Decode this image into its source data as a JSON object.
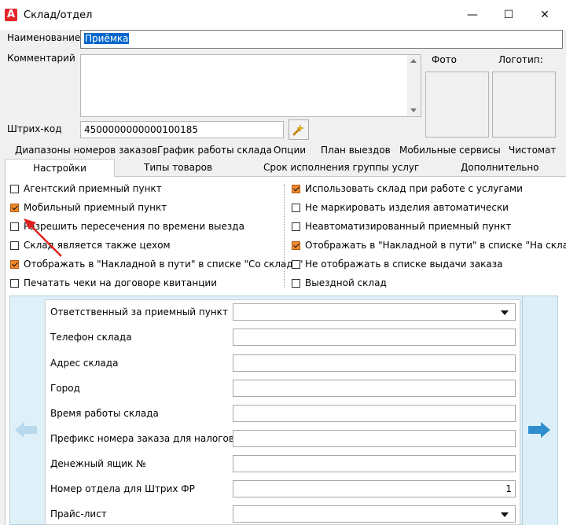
{
  "window": {
    "title": "Склад/отдел",
    "app_icon_letter": "A",
    "minimize": "—",
    "maximize": "☐",
    "close": "✕"
  },
  "form": {
    "name_label": "Наименование",
    "name_value": "Приёмка",
    "comment_label": "Комментарий",
    "comment_value": "",
    "photo_label": "Фото",
    "logo_label": "Логотип:",
    "barcode_label": "Штрих-код",
    "barcode_value": "4500000000000100185"
  },
  "tabs_top": [
    "Диапазоны номеров заказов",
    "График работы склада",
    "Опции",
    "План выездов",
    "Мобильные сервисы",
    "Чистомат"
  ],
  "tabs_bottom": [
    "Настройки",
    "Типы товаров",
    "Срок исполнения группы услуг",
    "Дополнительно"
  ],
  "active_tab": "Настройки",
  "checkboxes_left": [
    {
      "label": "Агентский приемный пункт",
      "checked": false
    },
    {
      "label": "Мобильный приемный пункт",
      "checked": true
    },
    {
      "label": "Разрешить пересечения по времени выезда",
      "checked": false
    },
    {
      "label": "Склад является также цехом",
      "checked": false
    },
    {
      "label": "Отображать в \"Накладной в пути\" в списке \"Со склада\"",
      "checked": true
    },
    {
      "label": "Печатать чеки на договоре квитанции",
      "checked": false
    }
  ],
  "checkboxes_right": [
    {
      "label": "Использовать склад при работе с услугами",
      "checked": true
    },
    {
      "label": "Не маркировать изделия автоматически",
      "checked": false
    },
    {
      "label": "Неавтоматизированный приемный пункт",
      "checked": false
    },
    {
      "label": "Отображать в \"Накладной в пути\" в списке \"На склад\"",
      "checked": true
    },
    {
      "label": "Не отображать в списке выдачи заказа",
      "checked": false
    },
    {
      "label": "Выездной склад",
      "checked": false
    }
  ],
  "fields": [
    {
      "label": "Ответственный за приемный пункт",
      "value": "",
      "type": "dropdown"
    },
    {
      "label": "Телефон склада",
      "value": "",
      "type": "text"
    },
    {
      "label": "Адрес склада",
      "value": "",
      "type": "text"
    },
    {
      "label": "Город",
      "value": "",
      "type": "text"
    },
    {
      "label": "Время работы склада",
      "value": "",
      "type": "text"
    },
    {
      "label": "Префикс номера заказа для налоговой",
      "value": "",
      "type": "text"
    },
    {
      "label": "Денежный ящик №",
      "value": "",
      "type": "text"
    },
    {
      "label": "Номер отдела для Штрих ФР",
      "value": "1",
      "type": "text"
    },
    {
      "label": "Прайс-лист",
      "value": "",
      "type": "dropdown"
    }
  ],
  "colors": {
    "accent": "#0066cc",
    "checkbox_on": "#f0892d",
    "arrow_red": "#e0201c",
    "nav_arrow": "#2f8fce",
    "nav_arrow_disabled": "#b8d8ec"
  }
}
